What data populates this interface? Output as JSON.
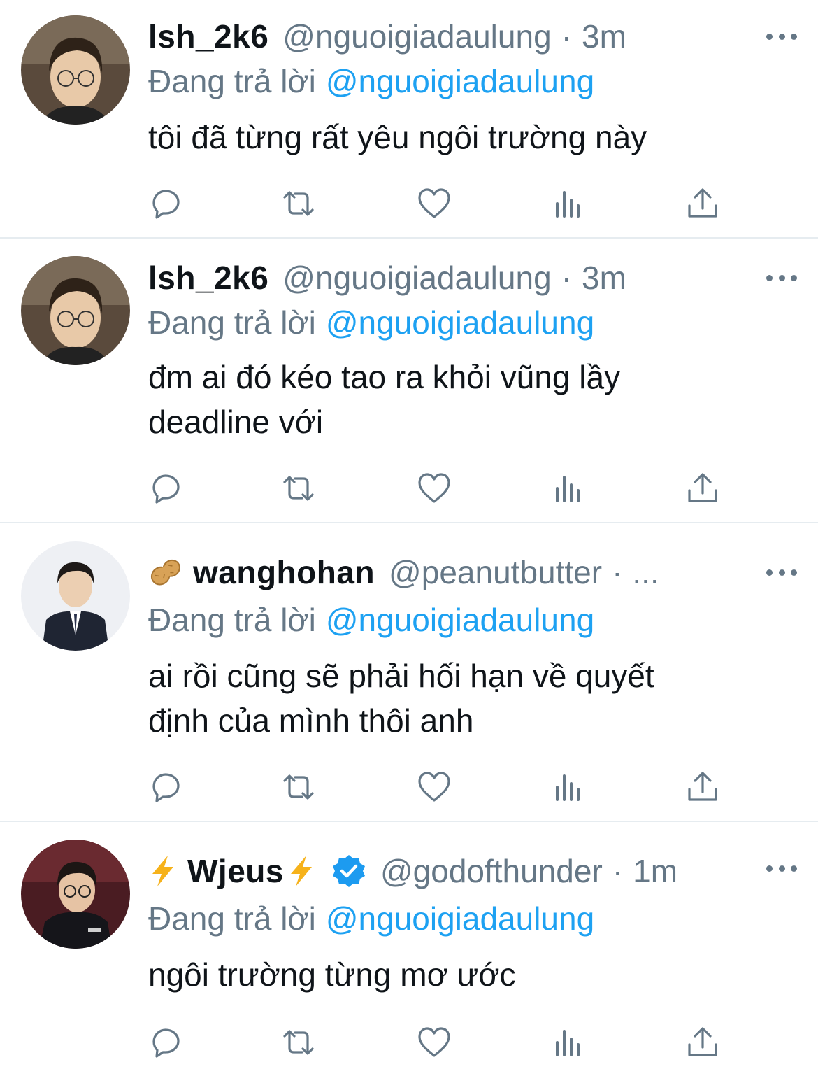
{
  "tweets": [
    {
      "display_name": "lsh_2k6",
      "handle": "@nguoigiadaulung",
      "separator": "·",
      "time": "3m",
      "reply_prefix": "Đang trả lời",
      "reply_handle": "@nguoigiadaulung",
      "text": "tôi đã từng rất yêu ngôi trường này"
    },
    {
      "display_name": "lsh_2k6",
      "handle": "@nguoigiadaulung",
      "separator": "·",
      "time": "3m",
      "reply_prefix": "Đang trả lời",
      "reply_handle": "@nguoigiadaulung",
      "text": "đm ai đó kéo tao ra khỏi vũng lầy\ndeadline với"
    },
    {
      "name_emoji": "peanut-emoji",
      "display_name": "wanghohan",
      "handle": "@peanutbutter",
      "separator": "·",
      "time": "...",
      "reply_prefix": "Đang trả lời",
      "reply_handle": "@nguoigiadaulung",
      "text": "ai rồi cũng sẽ phải hối hạn về quyết\nđịnh của mình thôi anh"
    },
    {
      "name_emoji": "lightning-emoji",
      "display_name": "Wjeus",
      "verified": true,
      "handle": "@godofthunder",
      "separator": "·",
      "time": "1m",
      "reply_prefix": "Đang trả lời",
      "reply_handle": "@nguoigiadaulung",
      "text": "ngôi trường từng mơ ước"
    }
  ],
  "actions": [
    "reply-icon",
    "retweet-icon",
    "like-icon",
    "analytics-icon",
    "share-icon"
  ],
  "colors": {
    "text": "#0f1419",
    "secondary": "#657786",
    "link": "#1da1f2",
    "divider": "#e6ecf0",
    "verified": "#1d9bf0"
  }
}
